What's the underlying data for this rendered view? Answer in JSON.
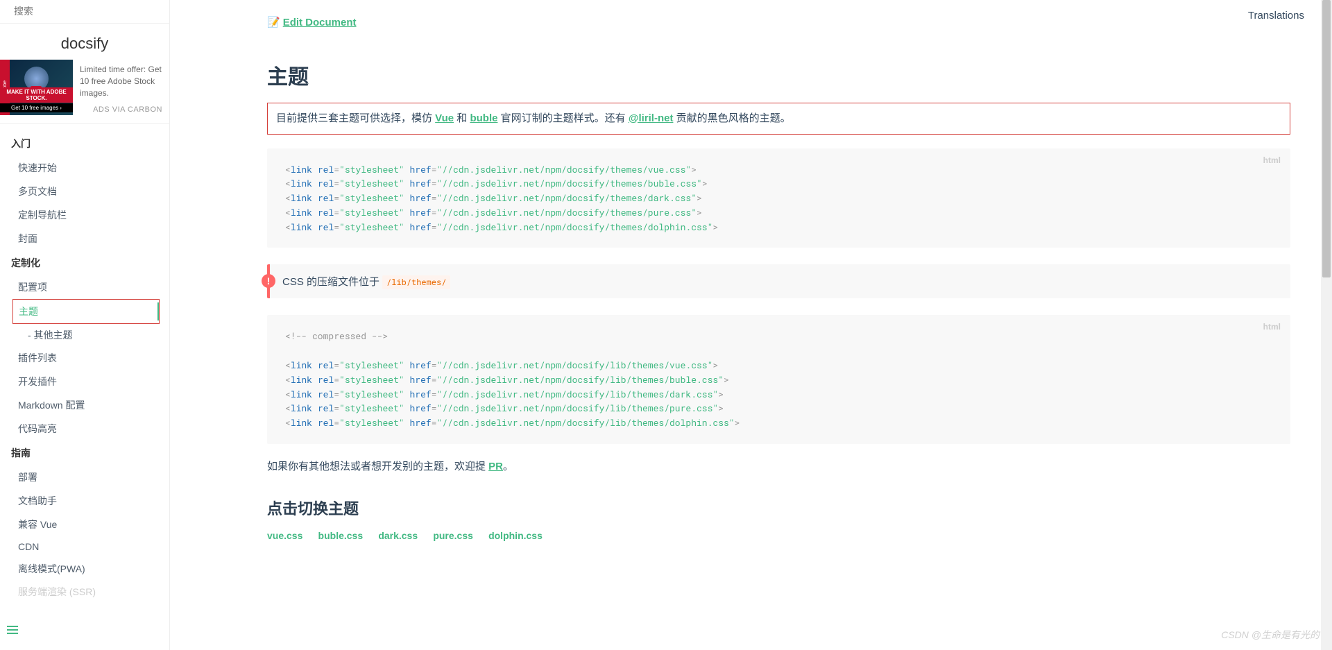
{
  "search": {
    "placeholder": "搜索"
  },
  "app_name": "docsify",
  "ad": {
    "badge": "St",
    "band1": "MAKE IT WITH ADOBE STOCK.",
    "band2": "Get 10 free images ›",
    "text": "Limited time offer: Get 10 free Adobe Stock images.",
    "via": "ADS VIA CARBON"
  },
  "top_nav": "Translations",
  "nav": {
    "s1": "入门",
    "s1_items": [
      "快速开始",
      "多页文档",
      "定制导航栏",
      "封面"
    ],
    "s2": "定制化",
    "s2_items": {
      "i0": "配置项",
      "i1": "主题",
      "i1_sub": "- 其他主题",
      "i2": "插件列表",
      "i3": "开发插件",
      "i4": "Markdown 配置",
      "i5": "代码高亮"
    },
    "s3": "指南",
    "s3_items": [
      "部署",
      "文档助手",
      "兼容 Vue",
      "CDN",
      "离线模式(PWA)"
    ],
    "faded": "服务端渲染 (SSR)"
  },
  "content": {
    "edit_icon": "📝",
    "edit": "Edit Document",
    "h1": "主题",
    "intro_pre": "目前提供三套主题可供选择，模仿 ",
    "intro_vue": "Vue",
    "intro_mid": " 和 ",
    "intro_buble": "buble",
    "intro_mid2": " 官网订制的主题样式。还有 ",
    "intro_liril": "@liril-net",
    "intro_post": " 贡献的黑色风格的主题。",
    "code1_lang": "html",
    "code1": {
      "u1": "//cdn.jsdelivr.net/npm/docsify/themes/vue.css",
      "u2": "//cdn.jsdelivr.net/npm/docsify/themes/buble.css",
      "u3": "//cdn.jsdelivr.net/npm/docsify/themes/dark.css",
      "u4": "//cdn.jsdelivr.net/npm/docsify/themes/pure.css",
      "u5": "//cdn.jsdelivr.net/npm/docsify/themes/dolphin.css"
    },
    "tip_text": "CSS 的压缩文件位于",
    "tip_code": "/lib/themes/",
    "code2_lang": "html",
    "code2": {
      "comment": "<!-- compressed -->",
      "u1": "//cdn.jsdelivr.net/npm/docsify/lib/themes/vue.css",
      "u2": "//cdn.jsdelivr.net/npm/docsify/lib/themes/buble.css",
      "u3": "//cdn.jsdelivr.net/npm/docsify/lib/themes/dark.css",
      "u4": "//cdn.jsdelivr.net/npm/docsify/lib/themes/pure.css",
      "u5": "//cdn.jsdelivr.net/npm/docsify/lib/themes/dolphin.css"
    },
    "pr_pre": "如果你有其他想法或者想开发别的主题，欢迎提 ",
    "pr_link": "PR",
    "pr_post": "。",
    "h2": "点击切换主题",
    "themes": [
      "vue.css",
      "buble.css",
      "dark.css",
      "pure.css",
      "dolphin.css"
    ]
  },
  "watermark": "CSDN @生命是有光的"
}
